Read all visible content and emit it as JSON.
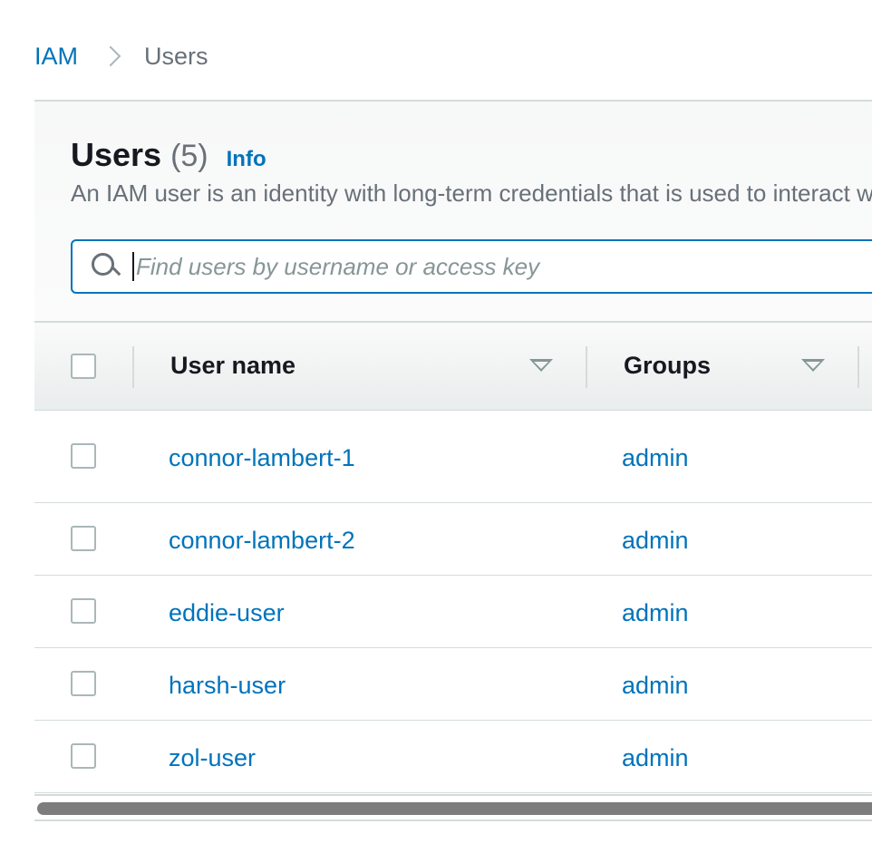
{
  "breadcrumb": {
    "root": "IAM",
    "current": "Users"
  },
  "header": {
    "title": "Users",
    "count": "(5)",
    "info_label": "Info",
    "description": "An IAM user is an identity with long-term credentials that is used to interact with AWS in an account."
  },
  "search": {
    "placeholder": "Find users by username or access key",
    "value": ""
  },
  "table": {
    "columns": [
      "User name",
      "Groups"
    ],
    "rows": [
      {
        "user": "connor-lambert-1",
        "groups": "admin"
      },
      {
        "user": "connor-lambert-2",
        "groups": "admin"
      },
      {
        "user": "eddie-user",
        "groups": "admin"
      },
      {
        "user": "harsh-user",
        "groups": "admin"
      },
      {
        "user": "zol-user",
        "groups": "admin"
      }
    ]
  },
  "colors": {
    "link": "#0073bb",
    "text": "#16191f",
    "muted": "#687078",
    "border": "#d5dbdb"
  }
}
